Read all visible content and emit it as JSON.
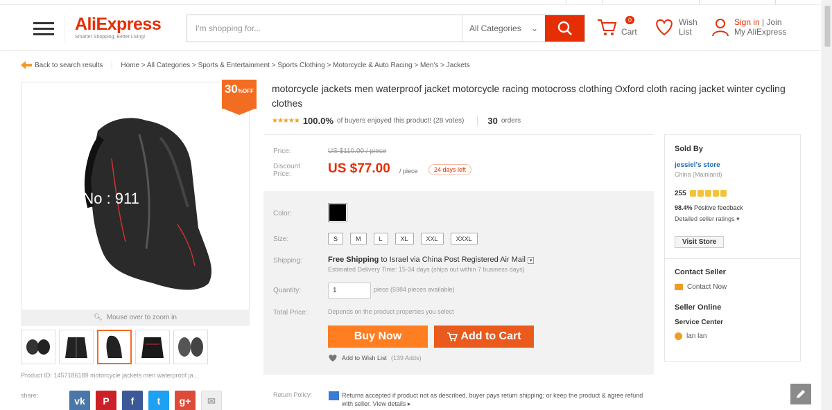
{
  "header": {
    "logo": "AliExpress",
    "tagline": "Smarter Shopping, Better Living!",
    "search_placeholder": "I'm shopping for...",
    "category": "All Categories",
    "cart_count": "0",
    "cart_label": "Cart",
    "wish_label1": "Wish",
    "wish_label2": "List",
    "signin": "Sign in",
    "join": "Join",
    "my_account": "My AliExpress"
  },
  "breadcrumb": {
    "back": "Back to search results",
    "path": "Home > All Categories > Sports & Entertainment > Sports Clothing > Motorcycle & Auto Racing > Men's > Jackets"
  },
  "gallery": {
    "discount_value": "30",
    "discount_suffix": "%",
    "discount_off": "OFF",
    "watermark": "e No : 911",
    "zoom_hint": "Mouse over to zoom in",
    "product_id": "Product ID: 1457186189 motorcycle jackets men waterproof ja...",
    "share_label": "share:"
  },
  "product": {
    "title": "motorcycle jackets men waterproof jacket motorcycle racing motocross clothing Oxford cloth racing jacket winter cycling clothes",
    "rating_pct": "100.0%",
    "rating_text": "of buyers enjoyed this product! (28 votes)",
    "orders_num": "30",
    "orders_label": "orders"
  },
  "price": {
    "price_label": "Price:",
    "old_price": "US $110.00 / piece",
    "discount_label": "Discount Price:",
    "new_price": "US $77.00",
    "per_piece": "/ piece",
    "days_left": "24 days left"
  },
  "options": {
    "color_label": "Color:",
    "color_value": "#000000",
    "size_label": "Size:",
    "sizes": [
      "S",
      "M",
      "L",
      "XL",
      "XXL",
      "XXXL"
    ],
    "shipping_label": "Shipping:",
    "ship_free": "Free Shipping",
    "ship_to": "to  Israel via China Post Registered Air Mail",
    "ship_est": "Estimated Delivery Time: 15-34 days (ships out within 7 business days)",
    "qty_label": "Quantity:",
    "qty_value": "1",
    "qty_avail": "piece (5984 pieces available)",
    "total_label": "Total Price:",
    "total_text": "Depends on the product properties you select",
    "buy_now": "Buy Now",
    "add_to_cart": "Add to Cart",
    "wish_text": "Add to Wish List",
    "wish_count": "(139 Adds)"
  },
  "returns": {
    "label": "Return Policy:",
    "text": "Returns accepted if product not as described, buyer pays return shipping; or keep the product & agree refund with seller. View details ▸"
  },
  "seller": {
    "sold_by": "Sold By",
    "store": "jessiel's store",
    "location": "China (Mainland)",
    "score": "255",
    "feedback_pct": "98.4%",
    "feedback_label": "Positive feedback",
    "detailed": "Detailed seller ratings",
    "visit": "Visit Store",
    "contact_title": "Contact Seller",
    "contact_now": "Contact Now",
    "online_title": "Seller Online",
    "service_center": "Service Center",
    "agent": "lan lan"
  },
  "colors": {
    "brand": "#e62e04",
    "buy": "#ff7e22",
    "cart": "#e95a1c"
  }
}
